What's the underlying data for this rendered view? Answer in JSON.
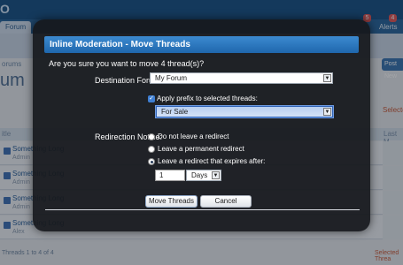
{
  "background": {
    "logo": "O",
    "nav_tab": "Forum",
    "alerts_label": "Alerts",
    "badges": [
      "5",
      "4"
    ],
    "subnav_label": "orums",
    "right_button": "Post New",
    "heading": "um",
    "selected_label": "Selected",
    "column_title": "itle",
    "column_last": "Last M",
    "rows": [
      {
        "title": "Something Long",
        "sub": "Admin"
      },
      {
        "title": "Something Long",
        "sub": "Admin"
      },
      {
        "title": "Something Long",
        "sub": "Admin"
      },
      {
        "title": "Something Long",
        "sub": "Alex"
      }
    ],
    "footer_left": "Threads 1 to 4 of 4",
    "footer_right": "Selected Threa"
  },
  "modal": {
    "title": "Inline Moderation - Move Threads",
    "question": "Are you sure you want to move 4 thread(s)?",
    "destination_label": "Destination Forum:",
    "destination_value": "My Forum",
    "apply_prefix_label": "Apply prefix to selected threads:",
    "apply_prefix_checked": true,
    "prefix_value": "For Sale",
    "redirect_label": "Redirection Notice:",
    "redirect_options": [
      {
        "label": "Do not leave a redirect",
        "checked": false
      },
      {
        "label": "Leave a permanent redirect",
        "checked": false
      },
      {
        "label": "Leave a redirect that expires after:",
        "checked": true
      }
    ],
    "expire_amount": "1",
    "expire_unit": "Days",
    "move_button": "Move Threads",
    "cancel_button": "Cancel"
  },
  "icons": {
    "select_arrow": "select-arrow-icon",
    "checkmark": "checkmark-icon"
  },
  "colors": {
    "header_blue": "#1f67ad",
    "checkbox_blue": "#3f7fd2",
    "modal_bg": "#16181c"
  }
}
